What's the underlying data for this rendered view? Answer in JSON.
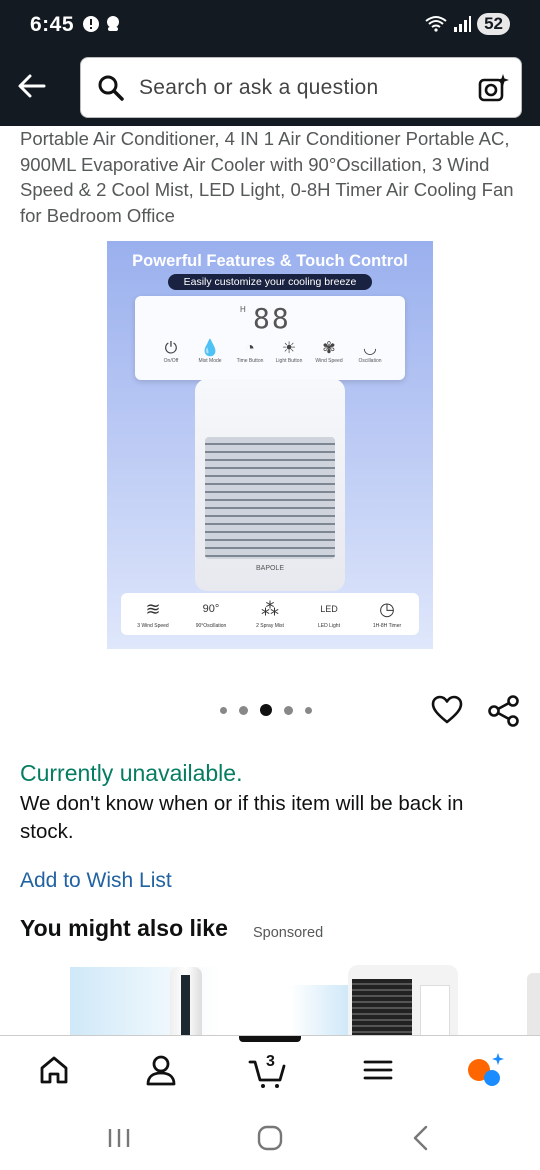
{
  "status_bar": {
    "time": "6:45",
    "battery": "52",
    "icons": [
      "alert-icon",
      "notification-icon",
      "wifi-icon",
      "signal-icon"
    ]
  },
  "header": {
    "back_icon": "back-arrow-icon",
    "search_placeholder": "Search or ask a question",
    "camera_icon": "camera-search-icon"
  },
  "product": {
    "title": "Portable Air Conditioner, 4 IN 1 Air Conditioner Portable AC, 900ML Evaporative Air Cooler with 90°Oscillation, 3 Wind Speed & 2 Cool Mist, LED Light, 0-8H Timer Air Cooling Fan for Bedroom Office",
    "image": {
      "headline": "Powerful Features & Touch Control",
      "subline": "Easily customize your cooling breeze",
      "display": "88",
      "display_h": "H",
      "controls": [
        {
          "label": "On/Off",
          "icon": "power-icon",
          "glyph": "⏻"
        },
        {
          "label": "Mist Mode",
          "icon": "drops-icon",
          "glyph": "💧"
        },
        {
          "label": "Time Button",
          "icon": "timer-icon",
          "glyph": "◔"
        },
        {
          "label": "Light Button",
          "icon": "light-icon",
          "glyph": "☀"
        },
        {
          "label": "Wind Speed",
          "icon": "fan-icon",
          "glyph": "✾"
        },
        {
          "label": "Oscillation",
          "icon": "oscillation-icon",
          "glyph": "◡"
        }
      ],
      "brand": "BAPOLE",
      "features": [
        {
          "label": "3 Wind Speed",
          "icon": "wind-icon",
          "glyph": "≋"
        },
        {
          "label": "90°Oscillation",
          "icon": "oscillation-icon",
          "glyph": "90°"
        },
        {
          "label": "2 Spray Mist",
          "icon": "mist-icon",
          "glyph": "⁂"
        },
        {
          "label": "LED Light",
          "icon": "led-icon",
          "glyph": "LED"
        },
        {
          "label": "1H-8H Timer",
          "icon": "timer-icon",
          "glyph": "◷"
        }
      ]
    },
    "carousel": {
      "count": 5,
      "active_index": 2
    },
    "availability": "Currently unavailable.",
    "stock_message": "We don't know when or if this item will be back in stock.",
    "wishlist_link": "Add to Wish List"
  },
  "recommendations": {
    "heading": "You might also like",
    "sponsored": "Sponsored"
  },
  "bottom_nav": {
    "tabs": [
      "home-icon",
      "account-icon",
      "cart-icon",
      "menu-icon",
      "rufus-icon"
    ],
    "cart_count": "3",
    "active_tab": "cart"
  },
  "colors": {
    "header_bg": "#131a22",
    "available_green": "#067d62",
    "link_blue": "#2162a1",
    "rufus_orange": "#ff6600",
    "rufus_blue": "#1a8cff"
  }
}
